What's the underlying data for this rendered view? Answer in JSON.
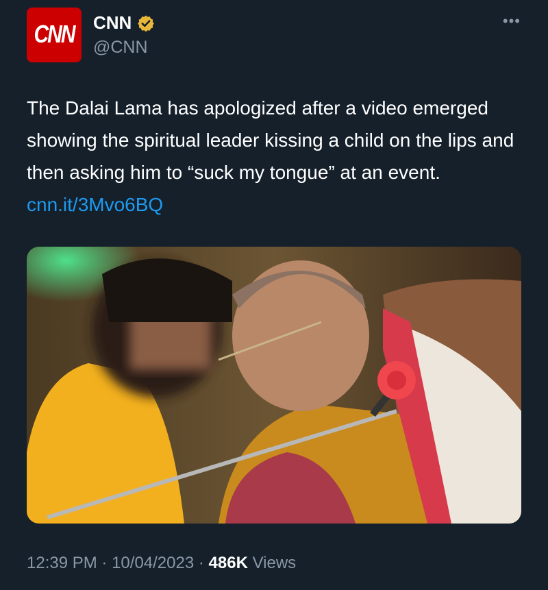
{
  "author": {
    "logo_text": "CNN",
    "display_name": "CNN",
    "handle": "@CNN",
    "verified_icon": "gold-verified-badge-icon",
    "more_icon": "more-horizontal-icon"
  },
  "tweet": {
    "text": "The Dalai Lama has apologized after a video emerged showing the spiritual leader kissing a child on the lips and then asking him to “suck my tongue” at an event. ",
    "link_text": "cnn.it/3Mvo6BQ"
  },
  "media": {
    "image": "photo-elder-monk-in-glasses-touching-foreheads-with-blurred-child-microphone"
  },
  "meta": {
    "time": "12:39 PM",
    "separator": "·",
    "date": "10/04/2023",
    "views_count": "486K",
    "views_label": "Views"
  },
  "colors": {
    "background": "#15202b",
    "link": "#1d9bf0",
    "secondary_text": "#8b98a5",
    "brand_red": "#cc0000",
    "verified_gold": "#e8b73a"
  }
}
